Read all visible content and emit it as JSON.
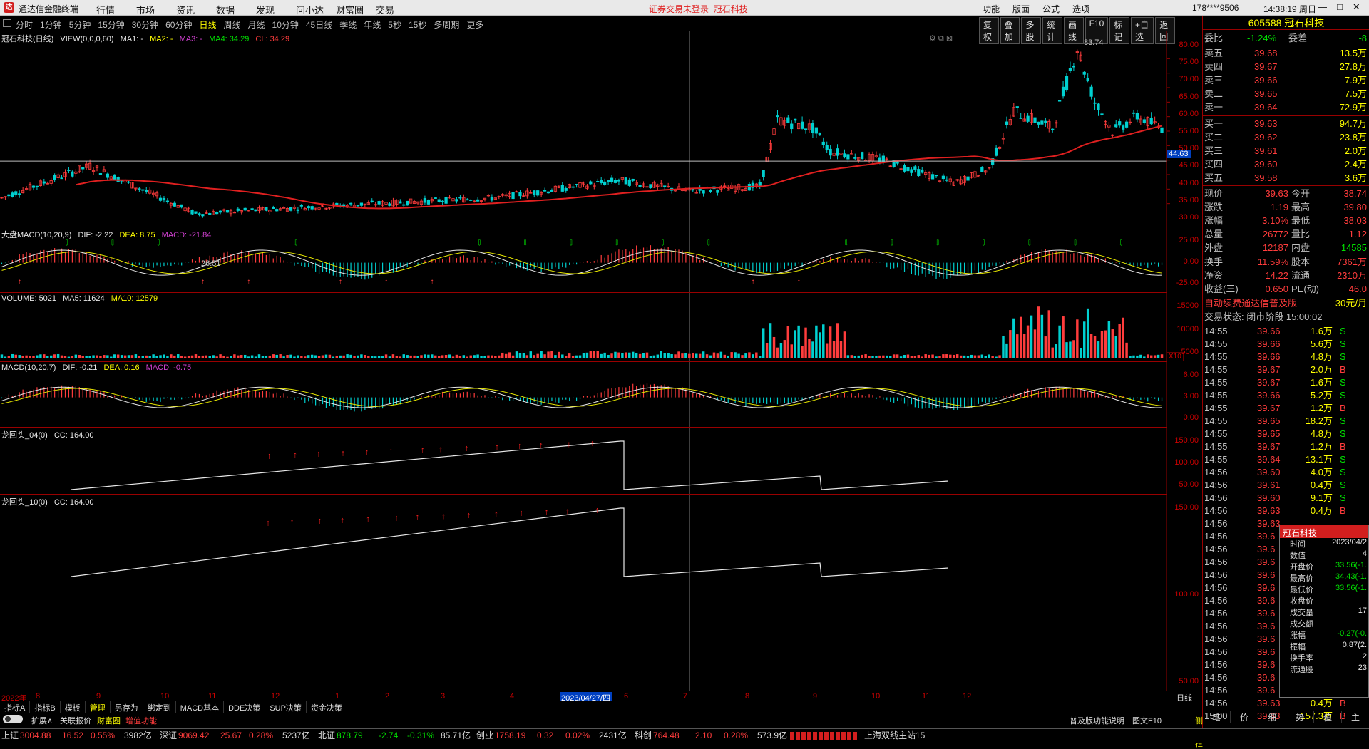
{
  "app": {
    "logo": "达",
    "name": "通达信金融终端",
    "menu": [
      "行情",
      "市场",
      "资讯",
      "数据",
      "发现",
      "问小达",
      "财富圈",
      "交易"
    ],
    "alert": "证券交易未登录",
    "alert_stock": "冠石科技",
    "right_menu": [
      "功能",
      "版面",
      "公式",
      "选项"
    ],
    "user": "178****9506",
    "time": "14:38:19 周日",
    "win": [
      "—",
      "□",
      "✕"
    ]
  },
  "periods": {
    "items": [
      "分时",
      "1分钟",
      "5分钟",
      "15分钟",
      "30分钟",
      "60分钟",
      "日线",
      "周线",
      "月线",
      "10分钟",
      "45日线",
      "季线",
      "年线",
      "5秒",
      "15秒",
      "多周期",
      "更多"
    ],
    "active": "日线"
  },
  "tools": [
    "复权",
    "叠加",
    "多股",
    "统计",
    "画线",
    "F10",
    "标记",
    "+自选",
    "返回"
  ],
  "panels": {
    "main": {
      "name": "冠石科技(日线)",
      "view": "VIEW(0,0,0,60)",
      "ma1": "MA1: -",
      "ma2": "MA2: -",
      "ma3": "MA3: -",
      "ma4": "MA4: 34.29",
      "cl": "CL: 34.29",
      "high_mark": "83.74",
      "low_mark": "26.51",
      "price_tag": "44.63",
      "axis": [
        "80.00",
        "75.00",
        "70.00",
        "65.00",
        "60.00",
        "55.00",
        "50.00",
        "45.00",
        "40.00",
        "35.00",
        "30.00"
      ]
    },
    "p2": {
      "name": "大盘MACD(10,20,9)",
      "dif": "DIF: -2.22",
      "dea": "DEA: 8.75",
      "macd": "MACD: -21.84",
      "axis": [
        "25.00",
        "0.00",
        "-25.00"
      ]
    },
    "p3": {
      "name": "VOLUME: 5021",
      "ma5": "MA5: 11624",
      "ma10": "MA10: 12579",
      "axis": [
        "15000",
        "10000",
        "5000"
      ],
      "unit": "X10"
    },
    "p4": {
      "name": "MACD(10,20,7)",
      "dif": "DIF: -0.21",
      "dea": "DEA: 0.16",
      "macd": "MACD: -0.75",
      "axis": [
        "6.00",
        "3.00",
        "0.00"
      ]
    },
    "p5": {
      "name": "龙回头_04(0)",
      "cc": "CC: 164.00",
      "axis": [
        "150.00",
        "100.00",
        "50.00"
      ]
    },
    "p6": {
      "name": "龙回头_10(0)",
      "cc": "CC: 164.00",
      "axis": [
        "150.00",
        "100.00",
        "50.00"
      ]
    }
  },
  "xaxis": {
    "labels": [
      "2022年",
      "8",
      "9",
      "10",
      "11",
      "12",
      "1",
      "2",
      "3",
      "4",
      "2023/04/27/四",
      "6",
      "7",
      "8",
      "9",
      "10",
      "11",
      "12"
    ],
    "mode": "日线"
  },
  "quote": {
    "code": "605588",
    "name": "冠石科技",
    "wb": {
      "label": "委比",
      "value": "-1.24%",
      "label2": "委差",
      "value2": "-8"
    },
    "asks": [
      {
        "l": "卖五",
        "p": "39.68",
        "v": "13.5万"
      },
      {
        "l": "卖四",
        "p": "39.67",
        "v": "27.8万"
      },
      {
        "l": "卖三",
        "p": "39.66",
        "v": "7.9万"
      },
      {
        "l": "卖二",
        "p": "39.65",
        "v": "7.5万"
      },
      {
        "l": "卖一",
        "p": "39.64",
        "v": "72.9万"
      }
    ],
    "bids": [
      {
        "l": "买一",
        "p": "39.63",
        "v": "94.7万"
      },
      {
        "l": "买二",
        "p": "39.62",
        "v": "23.8万"
      },
      {
        "l": "买三",
        "p": "39.61",
        "v": "2.0万"
      },
      {
        "l": "买四",
        "p": "39.60",
        "v": "2.4万"
      },
      {
        "l": "买五",
        "p": "39.58",
        "v": "3.6万"
      }
    ],
    "stats": [
      {
        "l1": "现价",
        "v1": "39.63",
        "l2": "今开",
        "v2": "38.74"
      },
      {
        "l1": "涨跌",
        "v1": "1.19",
        "l2": "最高",
        "v2": "39.80"
      },
      {
        "l1": "涨幅",
        "v1": "3.10%",
        "l2": "最低",
        "v2": "38.03"
      },
      {
        "l1": "总量",
        "v1": "26772",
        "l2": "量比",
        "v2": "1.12"
      },
      {
        "l1": "外盘",
        "v1": "12187",
        "l2": "内盘",
        "v2": "14585"
      }
    ],
    "stats2": [
      {
        "l1": "换手",
        "v1": "11.59%",
        "l2": "股本",
        "v2": "7361万"
      },
      {
        "l1": "净资",
        "v1": "14.22",
        "l2": "流通",
        "v2": "2310万"
      },
      {
        "l1": "收益(三)",
        "v1": "0.650",
        "l2": "PE(动)",
        "v2": "46.0"
      }
    ],
    "ad": "自动续费通达信普及版",
    "ad_price": "30元/月",
    "trade_status": "交易状态: 闭市阶段 15:00:02",
    "ticks": [
      {
        "t": "14:55",
        "p": "39.66",
        "v": "1.6万",
        "d": "S"
      },
      {
        "t": "14:55",
        "p": "39.66",
        "v": "5.6万",
        "d": "S"
      },
      {
        "t": "14:55",
        "p": "39.66",
        "v": "4.8万",
        "d": "S"
      },
      {
        "t": "14:55",
        "p": "39.67",
        "v": "2.0万",
        "d": "B"
      },
      {
        "t": "14:55",
        "p": "39.67",
        "v": "1.6万",
        "d": "S"
      },
      {
        "t": "14:55",
        "p": "39.66",
        "v": "5.2万",
        "d": "S"
      },
      {
        "t": "14:55",
        "p": "39.67",
        "v": "1.2万",
        "d": "B"
      },
      {
        "t": "14:55",
        "p": "39.65",
        "v": "18.2万",
        "d": "S"
      },
      {
        "t": "14:55",
        "p": "39.65",
        "v": "4.8万",
        "d": "S"
      },
      {
        "t": "14:55",
        "p": "39.67",
        "v": "1.2万",
        "d": "B"
      },
      {
        "t": "14:55",
        "p": "39.64",
        "v": "13.1万",
        "d": "S"
      },
      {
        "t": "14:56",
        "p": "39.60",
        "v": "4.0万",
        "d": "S"
      },
      {
        "t": "14:56",
        "p": "39.61",
        "v": "0.4万",
        "d": "S"
      },
      {
        "t": "14:56",
        "p": "39.60",
        "v": "9.1万",
        "d": "S"
      },
      {
        "t": "14:56",
        "p": "39.63",
        "v": "0.4万",
        "d": "B"
      },
      {
        "t": "14:56",
        "p": "39.63",
        "v": "",
        "d": ""
      },
      {
        "t": "14:56",
        "p": "39.6",
        "v": "",
        "d": ""
      },
      {
        "t": "14:56",
        "p": "39.6",
        "v": "",
        "d": ""
      },
      {
        "t": "14:56",
        "p": "39.6",
        "v": "",
        "d": ""
      },
      {
        "t": "14:56",
        "p": "39.6",
        "v": "",
        "d": ""
      },
      {
        "t": "14:56",
        "p": "39.6",
        "v": "",
        "d": ""
      },
      {
        "t": "14:56",
        "p": "39.6",
        "v": "",
        "d": ""
      },
      {
        "t": "14:56",
        "p": "39.6",
        "v": "",
        "d": ""
      },
      {
        "t": "14:56",
        "p": "39.6",
        "v": "",
        "d": ""
      },
      {
        "t": "14:56",
        "p": "39.6",
        "v": "",
        "d": ""
      },
      {
        "t": "14:56",
        "p": "39.6",
        "v": "",
        "d": ""
      },
      {
        "t": "14:56",
        "p": "39.6",
        "v": "",
        "d": ""
      },
      {
        "t": "14:56",
        "p": "39.6",
        "v": "",
        "d": ""
      },
      {
        "t": "14:56",
        "p": "39.6",
        "v": "",
        "d": ""
      },
      {
        "t": "14:56",
        "p": "39.63",
        "v": "0.4万",
        "d": "B"
      },
      {
        "t": "15:00",
        "p": "39.63",
        "v": "157.3万",
        "d": "B"
      }
    ],
    "rtabs": [
      "笔",
      "价",
      "细",
      "势",
      "值",
      "主"
    ]
  },
  "popup": {
    "title": "冠石科技",
    "rows": [
      {
        "l": "时间",
        "v": "2023/04/2"
      },
      {
        "l": "数值",
        "v": "4"
      },
      {
        "l": "开盘价",
        "v": "33.56(-1."
      },
      {
        "l": "最高价",
        "v": "34.43(-1."
      },
      {
        "l": "最低价",
        "v": "33.56(-1."
      },
      {
        "l": "收盘价",
        "v": ""
      },
      {
        "l": "成交量",
        "v": "17"
      },
      {
        "l": "成交额",
        "v": ""
      },
      {
        "l": "涨幅",
        "v": "-0.27(-0."
      },
      {
        "l": "振幅",
        "v": "0.87(2."
      },
      {
        "l": "换手率",
        "v": "2"
      },
      {
        "l": "流通股",
        "v": "23"
      }
    ]
  },
  "bottom": {
    "tabs": [
      "指标A",
      "指标B",
      "模板",
      "管理",
      "另存为",
      "绑定到",
      "MACD基本",
      "DDE决策",
      "SUP决策",
      "资金决策"
    ],
    "active": "管理",
    "tabs2": [
      "扩展∧",
      "关联报价",
      "财富圈",
      "增值功能"
    ],
    "right_links": [
      "普及版功能说明",
      "图文F10",
      "侧边栏"
    ]
  },
  "status": {
    "items": [
      {
        "n": "上证",
        "v": "3004.88",
        "c": "16.52",
        "p": "0.55%",
        "a": "3982亿"
      },
      {
        "n": "深证",
        "v": "9069.42",
        "c": "25.67",
        "p": "0.28%",
        "a": "5237亿"
      },
      {
        "n": "北证",
        "v": "878.79",
        "c": "-2.74",
        "p": "-0.31%",
        "a": "85.71亿"
      },
      {
        "n": "创业",
        "v": "1758.19",
        "c": "0.32",
        "p": "0.02%",
        "a": "2431亿"
      },
      {
        "n": "科创",
        "v": "764.48",
        "c": "2.10",
        "p": "0.28%",
        "a": "573.9亿"
      }
    ],
    "server": "上海双线主站15"
  },
  "chart_data": {
    "type": "candlestick",
    "title": "冠石科技(日线)",
    "ylim": [
      25,
      85
    ],
    "key_points": [
      {
        "x": "2022-07",
        "close": 32
      },
      {
        "x": "2022-08",
        "close": 43
      },
      {
        "x": "2022-10",
        "close": 26.51
      },
      {
        "x": "2023-04-27",
        "close": 34.29
      },
      {
        "x": "2023-05",
        "close": 59
      },
      {
        "x": "2023-06",
        "close": 47
      },
      {
        "x": "2023-08",
        "close": 37
      },
      {
        "x": "2023-09",
        "close": 62
      },
      {
        "x": "2023-10",
        "close": 83.74
      },
      {
        "x": "2023-11",
        "close": 55
      }
    ],
    "ma_line": "MA4",
    "volume_ylim": [
      0,
      17000
    ]
  }
}
